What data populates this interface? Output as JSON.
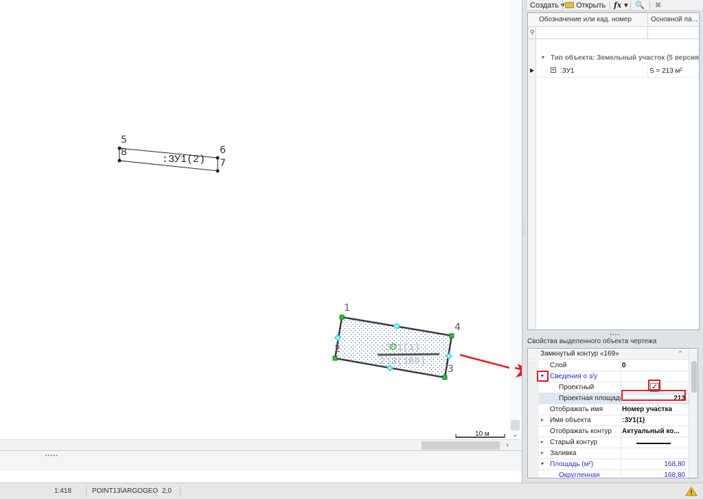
{
  "drawing": {
    "parcel2_label": ":ЗУ1(2)",
    "parcel2_points": [
      "5",
      "6",
      "7",
      "8"
    ],
    "parcel1_label": ":ЗУ1(1)",
    "parcel1_area_label": "213(169)",
    "parcel1_points": [
      "1",
      "2",
      "3",
      "4"
    ],
    "scale_bar_label": "10 м"
  },
  "toolbar": {
    "create_label": "Создать",
    "open_label": "Открыть",
    "fx_label": "fx"
  },
  "grid": {
    "columns": [
      "Обозначение или кад. номер",
      "Основной па..."
    ],
    "group_label": "Тип объекта: Земельный участок (5 версия)",
    "rows": [
      {
        "name": ":ЗУ1",
        "value": "S = 213 м²"
      }
    ]
  },
  "properties": {
    "title": "Свойства выделенного объекта чертежа",
    "header": "Замкнутый контур «169»",
    "rows": [
      {
        "label": "Слой",
        "value": "0"
      },
      {
        "label": "Сведения о з/у",
        "value": ""
      },
      {
        "label": "Проектный",
        "value": "✓"
      },
      {
        "label": "Проектная площадь",
        "value": "213"
      },
      {
        "label": "Отображать имя",
        "value": "Номер участка"
      },
      {
        "label": "Имя объекта",
        "value": ":ЗУ1(1)"
      },
      {
        "label": "Отображать контур",
        "value": "Актуальный ко..."
      },
      {
        "label": "Старый контур",
        "value": ""
      },
      {
        "label": "Заливка",
        "value": ""
      },
      {
        "label": "Площадь (м²)",
        "value": "168,80"
      },
      {
        "label": "Округленная",
        "value": "168,80"
      }
    ]
  },
  "status": {
    "scale": "1:418",
    "layer": "POINT13\\ARGOGEO",
    "value": "2,0"
  },
  "colors": {
    "accent_red": "#e01e1e",
    "blue_link": "#2a2acb",
    "vertex_green": "#2ec22e",
    "midpoint_cyan": "#1fd2e6"
  }
}
